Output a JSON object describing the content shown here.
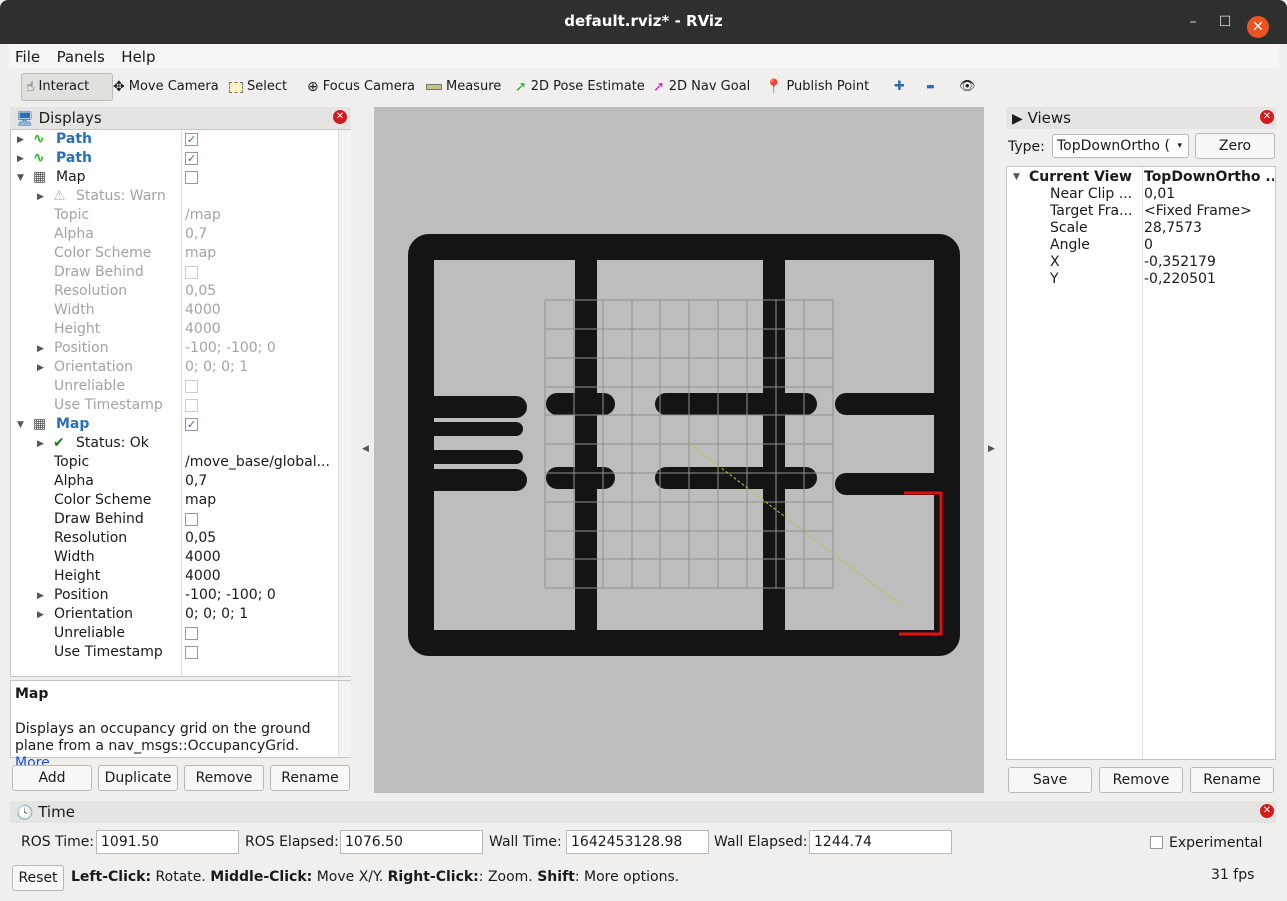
{
  "window": {
    "title": "default.rviz* - RViz",
    "minimize": "–",
    "maximize": "☐",
    "close": "✕"
  },
  "menu": {
    "file": "File",
    "panels": "Panels",
    "help": "Help"
  },
  "toolbar": {
    "interact": "Interact",
    "move_camera": "Move Camera",
    "select": "Select",
    "focus_camera": "Focus Camera",
    "measure": "Measure",
    "pose_estimate": "2D Pose Estimate",
    "nav_goal": "2D Nav Goal",
    "publish_point": "Publish Point",
    "plus": "✚",
    "minus": "▬",
    "eye": "👁"
  },
  "displays": {
    "header": "Displays",
    "rows": [
      {
        "label": "Path",
        "value": ""
      },
      {
        "label": "Path",
        "value": ""
      },
      {
        "label": "Map",
        "value": ""
      },
      {
        "label": "Status: Warn",
        "value": ""
      },
      {
        "label": "Topic",
        "value": "/map"
      },
      {
        "label": "Alpha",
        "value": "0,7"
      },
      {
        "label": "Color Scheme",
        "value": "map"
      },
      {
        "label": "Draw Behind",
        "value": ""
      },
      {
        "label": "Resolution",
        "value": "0,05"
      },
      {
        "label": "Width",
        "value": "4000"
      },
      {
        "label": "Height",
        "value": "4000"
      },
      {
        "label": "Position",
        "value": "-100; -100; 0"
      },
      {
        "label": "Orientation",
        "value": "0; 0; 0; 1"
      },
      {
        "label": "Unreliable",
        "value": ""
      },
      {
        "label": "Use Timestamp",
        "value": ""
      },
      {
        "label": "Map",
        "value": ""
      },
      {
        "label": "Status: Ok",
        "value": ""
      },
      {
        "label": "Topic",
        "value": "/move_base/global..."
      },
      {
        "label": "Alpha",
        "value": "0,7"
      },
      {
        "label": "Color Scheme",
        "value": "map"
      },
      {
        "label": "Draw Behind",
        "value": ""
      },
      {
        "label": "Resolution",
        "value": "0,05"
      },
      {
        "label": "Width",
        "value": "4000"
      },
      {
        "label": "Height",
        "value": "4000"
      },
      {
        "label": "Position",
        "value": "-100; -100; 0"
      },
      {
        "label": "Orientation",
        "value": "0; 0; 0; 1"
      },
      {
        "label": "Unreliable",
        "value": ""
      },
      {
        "label": "Use Timestamp",
        "value": ""
      }
    ],
    "desc_title": "Map",
    "desc_text": "Displays an occupancy grid on the ground plane from a nav_msgs::OccupancyGrid.",
    "desc_link": "More",
    "add": "Add",
    "duplicate": "Duplicate",
    "remove": "Remove",
    "rename": "Rename"
  },
  "views": {
    "header": "Views",
    "type_label": "Type:",
    "type_value": "TopDownOrtho (",
    "zero": "Zero",
    "current_view": "Current View",
    "current_view_value": "TopDownOrtho ...",
    "props": [
      {
        "label": "Near Clip ...",
        "value": "0,01"
      },
      {
        "label": "Target Fra...",
        "value": "<Fixed Frame>"
      },
      {
        "label": "Scale",
        "value": "28,7573"
      },
      {
        "label": "Angle",
        "value": "0"
      },
      {
        "label": "X",
        "value": "-0,352179"
      },
      {
        "label": "Y",
        "value": "-0,220501"
      }
    ],
    "save": "Save",
    "remove": "Remove",
    "rename": "Rename"
  },
  "time": {
    "header": "Time",
    "ros_time_label": "ROS Time:",
    "ros_time": "1091.50",
    "ros_elapsed_label": "ROS Elapsed:",
    "ros_elapsed": "1076.50",
    "wall_time_label": "Wall Time:",
    "wall_time": "1642453128.98",
    "wall_elapsed_label": "Wall Elapsed:",
    "wall_elapsed": "1244.74",
    "experimental": "Experimental"
  },
  "status": {
    "reset": "Reset",
    "left_click": "Left-Click:",
    "left_click_text": " Rotate. ",
    "middle_click": "Middle-Click:",
    "middle_click_text": " Move X/Y. ",
    "right_click": "Right-Click:",
    "right_click_text": ": Zoom. ",
    "shift": "Shift",
    "shift_text": ": More options.",
    "fps": "31 fps"
  }
}
